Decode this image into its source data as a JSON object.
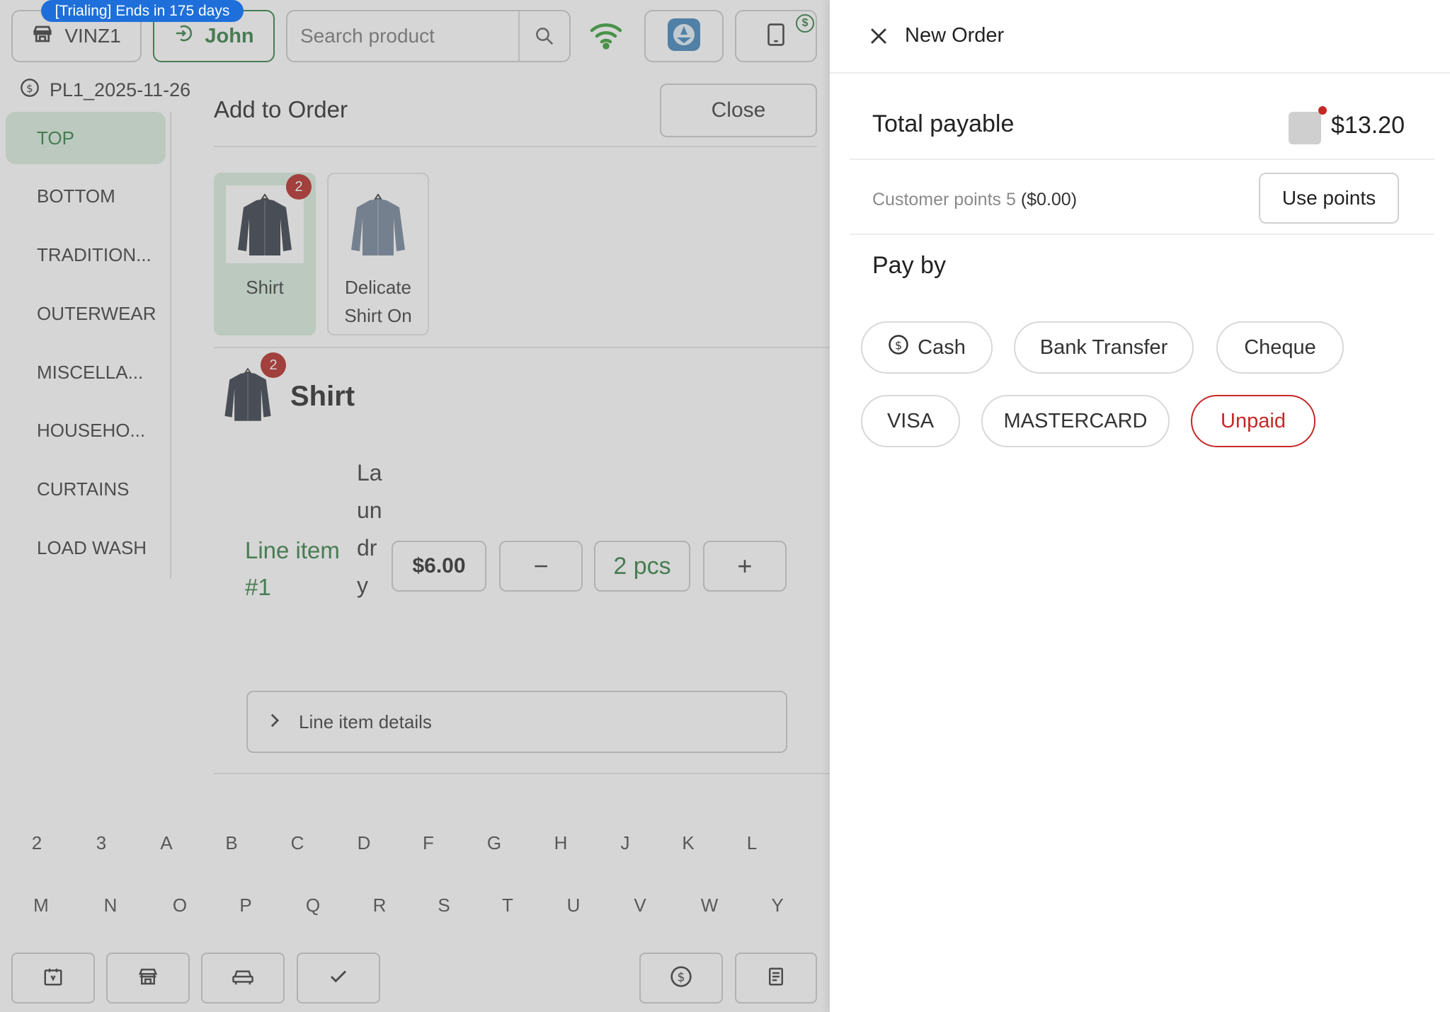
{
  "header": {
    "trial_banner": "[Trialing] Ends in 175 days",
    "store_label": "VINZ1",
    "user_label": "John",
    "search_placeholder": "Search product",
    "pricelist_label": "PL1_2025-11-26"
  },
  "sidebar": {
    "items": [
      {
        "label": "TOP",
        "active": true
      },
      {
        "label": "BOTTOM"
      },
      {
        "label": "TRADITION..."
      },
      {
        "label": "OUTERWEAR"
      },
      {
        "label": "MISCELLA..."
      },
      {
        "label": "HOUSEHO..."
      },
      {
        "label": "CURTAINS"
      },
      {
        "label": "LOAD WASH"
      }
    ]
  },
  "add_to_order": {
    "title": "Add to Order",
    "close_label": "Close",
    "products": [
      {
        "name": "Shirt",
        "badge": "2",
        "selected": true
      },
      {
        "name": "Delicate Shirt On",
        "selected": false
      }
    ],
    "selected_item": {
      "name": "Shirt",
      "badge": "2",
      "line_item_label": "Line item #1",
      "service": "Laundry",
      "price": "$6.00",
      "minus": "−",
      "quantity": "2 pcs",
      "plus": "+",
      "details_label": "Line item details"
    }
  },
  "letter_index": {
    "row1": [
      "2",
      "3",
      "A",
      "B",
      "C",
      "D",
      "F",
      "G",
      "H",
      "J",
      "K",
      "L"
    ],
    "row2": [
      "M",
      "N",
      "O",
      "P",
      "Q",
      "R",
      "S",
      "T",
      "U",
      "V",
      "W",
      "Y"
    ]
  },
  "bottom_bar": {
    "icons": [
      "calendar-icon",
      "store-icon",
      "car-icon",
      "check-icon",
      "dollar-icon",
      "receipt-icon"
    ]
  },
  "panel": {
    "title": "New Order",
    "total_label": "Total payable",
    "total_amount": "$13.20",
    "points_text": "Customer points 5",
    "points_value": "($0.00)",
    "use_points_label": "Use points",
    "pay_by_label": "Pay by",
    "methods": [
      {
        "label": "Cash",
        "icon": "dollar-icon"
      },
      {
        "label": "Bank Transfer"
      },
      {
        "label": "Cheque"
      },
      {
        "label": "VISA"
      },
      {
        "label": "MASTERCARD"
      },
      {
        "label": "Unpaid",
        "accent": "#c62828"
      }
    ]
  },
  "colors": {
    "primary_green": "#2c7a3d",
    "selected_bg": "#d7ecdb",
    "badge_red": "#b0201c",
    "trial_blue": "#1e6fd9",
    "unpaid_red": "#c62828"
  }
}
